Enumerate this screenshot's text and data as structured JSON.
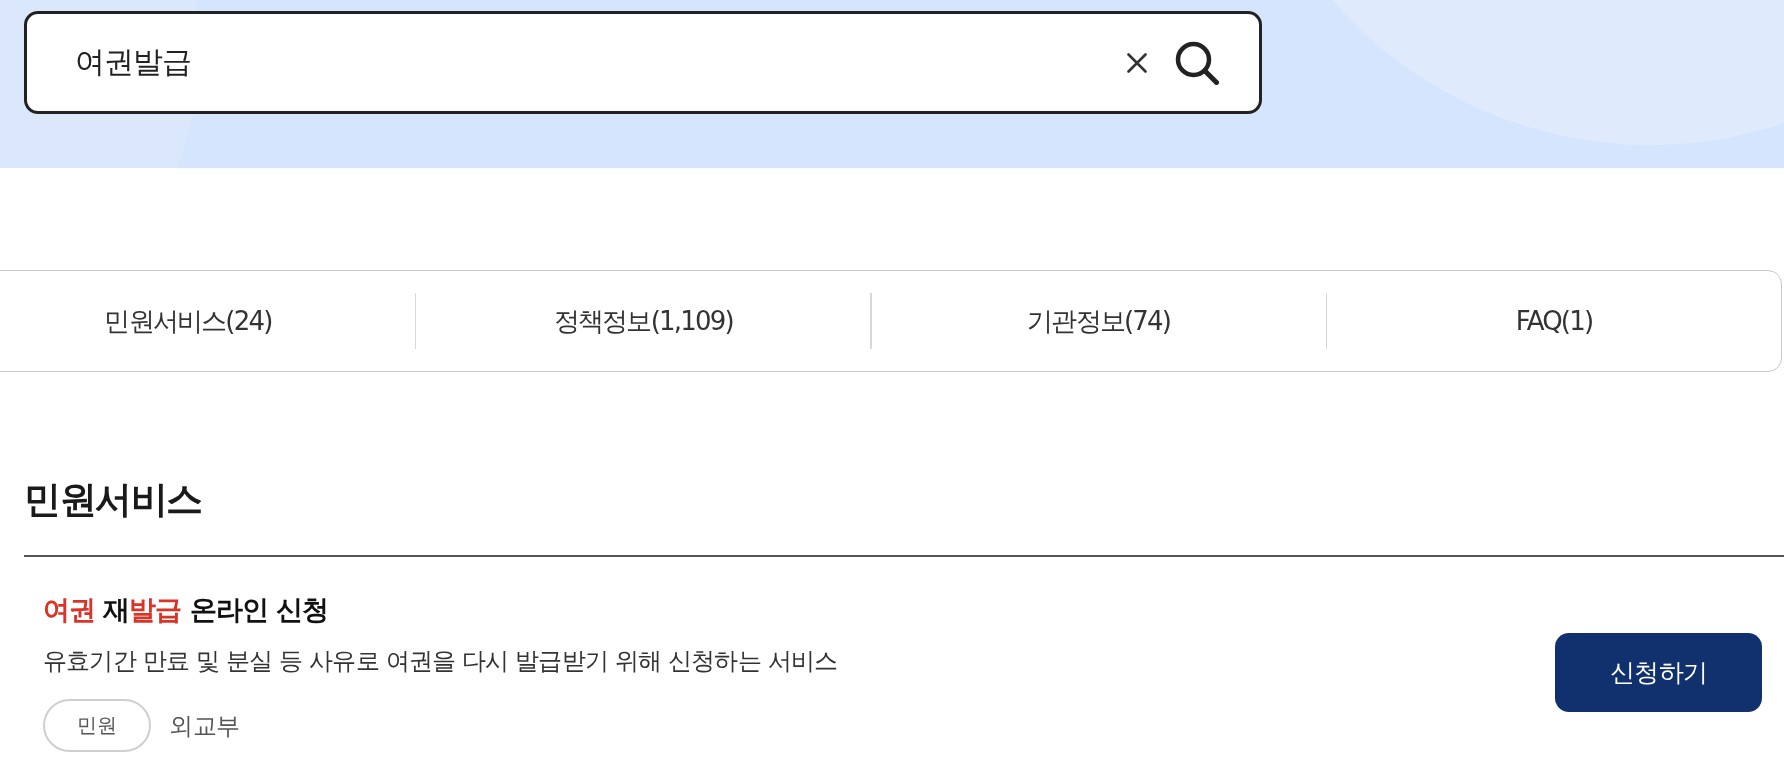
{
  "search": {
    "value": "여권발급"
  },
  "tabs": [
    {
      "label": "민원서비스(24)"
    },
    {
      "label": "정책정보(1,109)"
    },
    {
      "label": "기관정보(74)"
    },
    {
      "label": "FAQ(1)"
    }
  ],
  "section": {
    "title": "민원서비스",
    "results": [
      {
        "title_parts": [
          {
            "text": "여권",
            "highlight": true
          },
          {
            "text": " 재",
            "highlight": false
          },
          {
            "text": "발급",
            "highlight": true
          },
          {
            "text": " 온라인 신청",
            "highlight": false
          }
        ],
        "description": "유효기간 만료 및 분실 등 사유로 여권을 다시 발급받기 위해 신청하는 서비스",
        "tag": "민원",
        "agency": "외교부",
        "button": "신청하기"
      }
    ]
  }
}
